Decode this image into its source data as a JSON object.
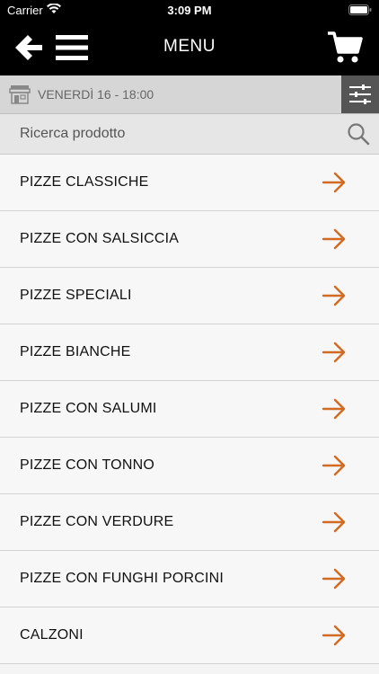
{
  "status": {
    "carrier": "Carrier",
    "time": "3:09 PM"
  },
  "nav": {
    "title": "MENU"
  },
  "date": {
    "text": "VENERDÌ 16 - 18:00"
  },
  "search": {
    "placeholder": "Ricerca prodotto"
  },
  "colors": {
    "accent": "#d26a1f",
    "bar": "#000000",
    "filter_bg": "#555555"
  },
  "categories": [
    {
      "label": "PIZZE CLASSICHE"
    },
    {
      "label": "PIZZE CON SALSICCIA"
    },
    {
      "label": "PIZZE SPECIALI"
    },
    {
      "label": "PIZZE BIANCHE"
    },
    {
      "label": "PIZZE CON SALUMI"
    },
    {
      "label": "PIZZE CON TONNO"
    },
    {
      "label": "PIZZE CON VERDURE"
    },
    {
      "label": "PIZZE CON FUNGHI PORCINI"
    },
    {
      "label": "CALZONI"
    }
  ]
}
